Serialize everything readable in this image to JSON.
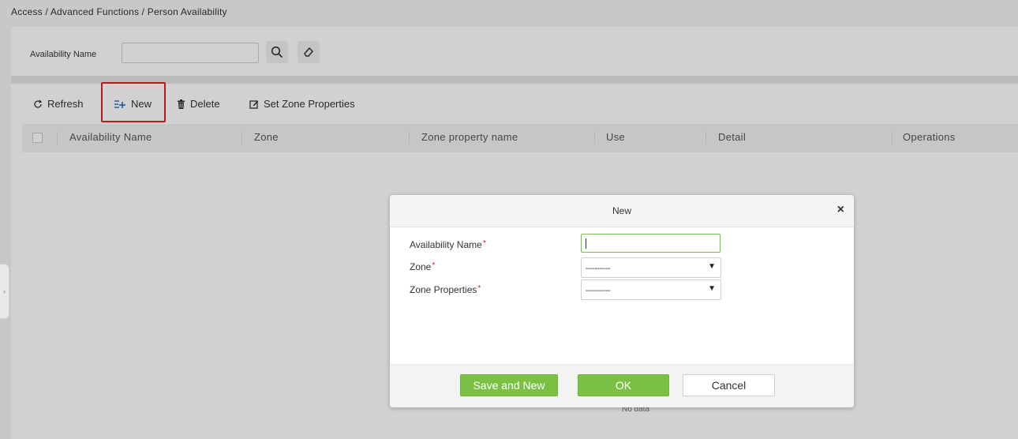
{
  "breadcrumb": "Access / Advanced Functions / Person Availability",
  "search": {
    "label": "Availability Name",
    "value": "",
    "search_icon": "search-icon",
    "clear_icon": "eraser-icon"
  },
  "toolbar": {
    "refresh": "Refresh",
    "new": "New",
    "delete": "Delete",
    "set_zone_properties": "Set Zone Properties"
  },
  "table": {
    "columns": [
      "Availability Name",
      "Zone",
      "Zone property name",
      "Use",
      "Detail",
      "Operations"
    ],
    "empty_text": "No data"
  },
  "dialog": {
    "title": "New",
    "close_icon": "close-icon",
    "fields": {
      "availability_name": {
        "label": "Availability Name",
        "value": ""
      },
      "zone": {
        "label": "Zone",
        "selected": "-----------"
      },
      "zone_properties": {
        "label": "Zone Properties",
        "selected": "-----------"
      }
    },
    "required_mark": "*",
    "buttons": {
      "save_and_new": "Save and New",
      "ok": "OK",
      "cancel": "Cancel"
    }
  },
  "colors": {
    "accent_green": "#7ac143",
    "highlight_red": "#e02020"
  }
}
